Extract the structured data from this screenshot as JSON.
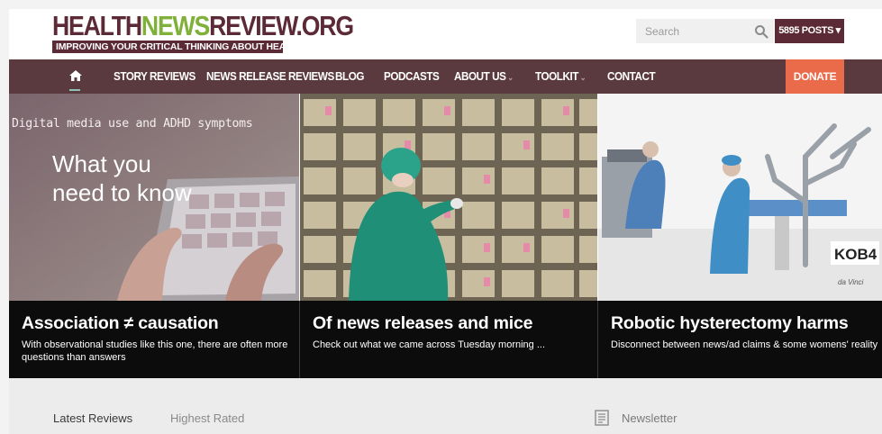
{
  "header": {
    "logo": {
      "part_one": "HEALTH",
      "part_two": "NEWS",
      "part_three": "REVIEW.ORG",
      "tagline": "IMPROVING YOUR CRITICAL THINKING ABOUT HEALTH CARE"
    },
    "search": {
      "placeholder": "Search",
      "icon": "search-icon"
    },
    "posts_button": "5895 POSTS ▾"
  },
  "nav": {
    "home_icon": "home-icon",
    "items": [
      {
        "label": "STORY REVIEWS",
        "dropdown": false
      },
      {
        "label": "NEWS RELEASE REVIEWS",
        "dropdown": false
      },
      {
        "label": "BLOG",
        "dropdown": false
      },
      {
        "label": "PODCASTS",
        "dropdown": false
      },
      {
        "label": "ABOUT US",
        "dropdown": true
      },
      {
        "label": "TOOLKIT",
        "dropdown": true
      },
      {
        "label": "CONTACT",
        "dropdown": false
      }
    ],
    "caret": "⌄",
    "donate": "DONATE",
    "colors": {
      "nav_bg": "#5b3a3f",
      "donate": "#e96b4a",
      "logo_maroon": "#5b2a36",
      "logo_green": "#7fb03a"
    }
  },
  "hero": [
    {
      "image_text": {
        "small": "Digital media use and ADHD symptoms",
        "big": "What you need to know"
      },
      "title": "Association ≠ causation",
      "subtitle": "With observational studies like this one, there are often more questions than answers"
    },
    {
      "title": "Of news releases and mice",
      "subtitle": "Check out what we came across Tuesday morning ..."
    },
    {
      "image_text": {
        "watermark": "KOB4",
        "brand": "da Vinci"
      },
      "title": "Robotic hysterectomy harms",
      "subtitle": "Disconnect between news/ad claims & some womens' reality"
    }
  ],
  "lower": {
    "tabs": [
      {
        "label": "Latest Reviews",
        "active": true
      },
      {
        "label": "Highest Rated",
        "active": false
      }
    ],
    "newsletter": {
      "icon": "newsletter-icon",
      "label": "Newsletter"
    }
  }
}
